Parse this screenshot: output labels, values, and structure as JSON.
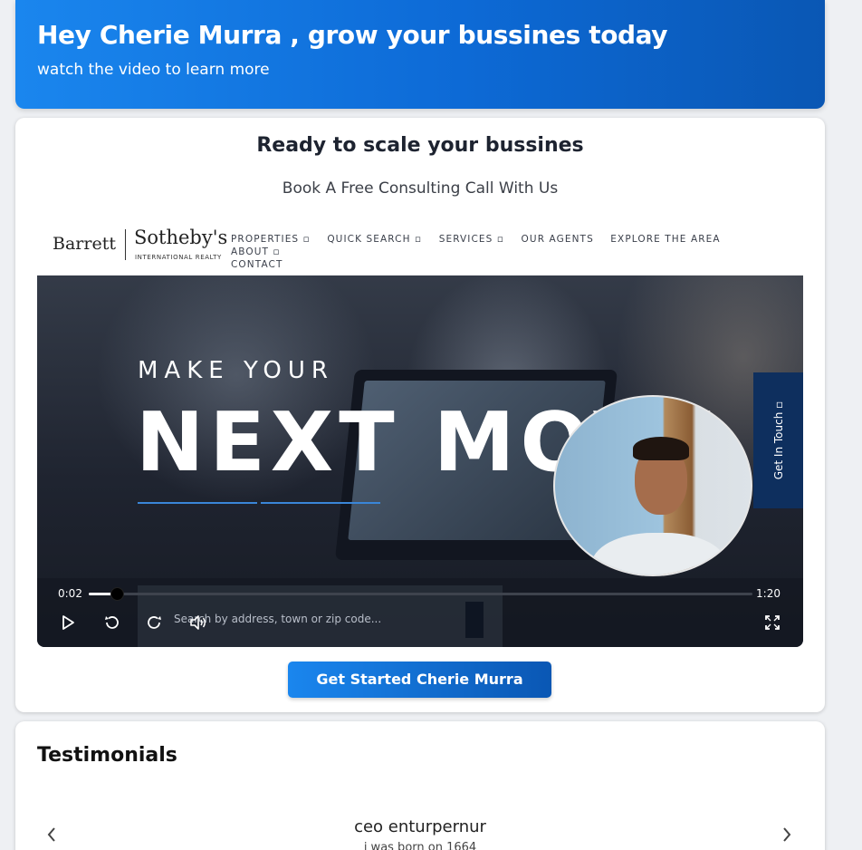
{
  "hero": {
    "title": "Hey Cherie Murra , grow your bussines today",
    "subtitle": "watch the video to learn more"
  },
  "main": {
    "title": "Ready to scale your bussines",
    "subtitle": "Book A Free Consulting Call With Us",
    "cta_label": "Get Started Cherie Murra"
  },
  "video": {
    "logo": {
      "barrett": "Barrett",
      "sothebys": "Sotheby's",
      "international": "INTERNATIONAL REALTY"
    },
    "nav": [
      "PROPERTIES ▫",
      "QUICK SEARCH ▫",
      "SERVICES ▫",
      "OUR AGENTS",
      "EXPLORE THE AREA",
      "ABOUT ▫",
      "CONTACT"
    ],
    "headline_small": "MAKE YOUR",
    "headline_big": "NEXT MOVE",
    "get_in_touch": "Get In Touch ▫",
    "search_placeholder": "Search by address, town or zip code...",
    "current_time": "0:02",
    "duration": "1:20",
    "progress": 0.025
  },
  "testimonials": {
    "title": "Testimonials",
    "name": "ceo enturpernur",
    "bio": "i was born on 1664"
  },
  "colors": {
    "accent_start": "#1a86ee",
    "accent_end": "#0a57b4",
    "dark_navy": "#0e2f5e"
  }
}
